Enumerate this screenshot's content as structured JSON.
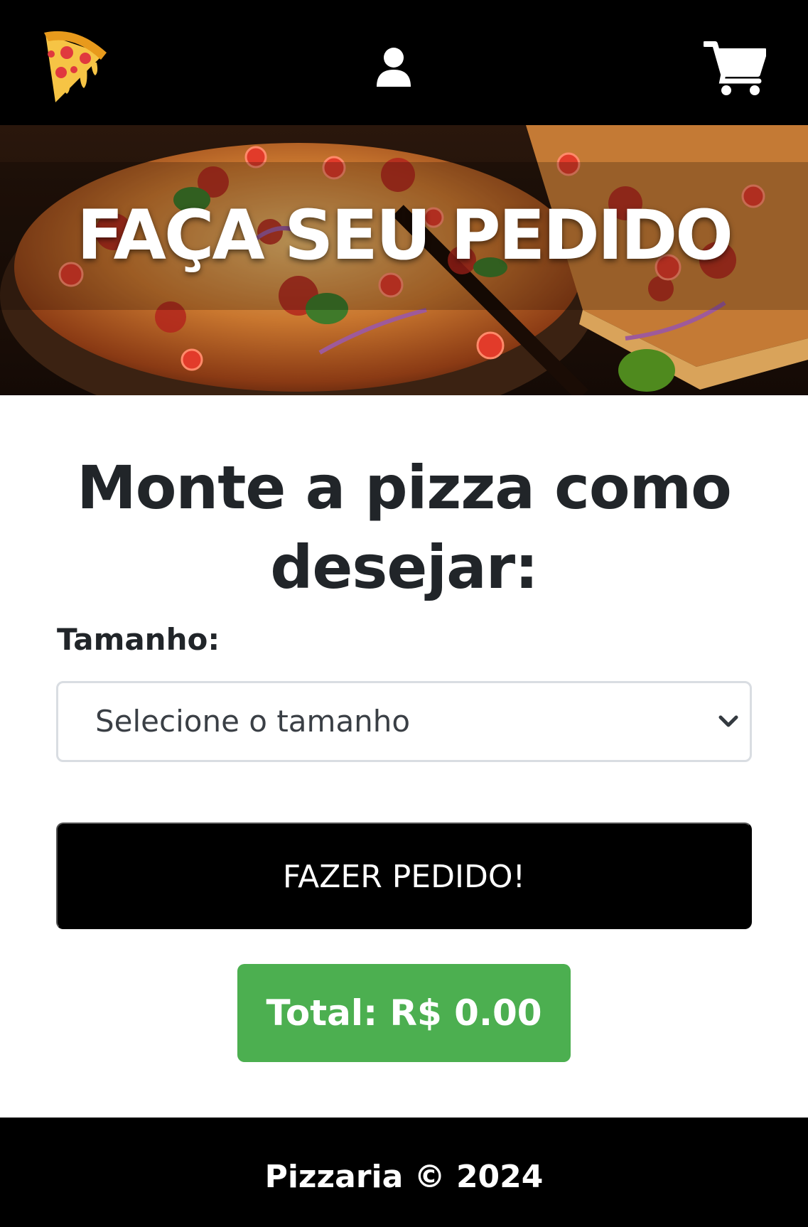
{
  "header": {
    "logo_icon": "pizza-slice-icon",
    "user_icon": "user-icon",
    "cart_icon": "shopping-cart-icon"
  },
  "hero": {
    "title": "FAÇA SEU PEDIDO",
    "background": "pizza-photo"
  },
  "main": {
    "heading": "Monte a pizza como desejar:",
    "size_label": "Tamanho:",
    "size_select": {
      "selected": "Selecione o tamanho"
    },
    "order_button_label": "FAZER PEDIDO!",
    "total_label": "Total: R$ 0.00"
  },
  "footer": {
    "text": "Pizzaria © 2024"
  },
  "colors": {
    "navbar": "#000000",
    "order_button": "#000000",
    "total_badge": "#4caf50",
    "footer": "#000000",
    "text": "#212529"
  }
}
